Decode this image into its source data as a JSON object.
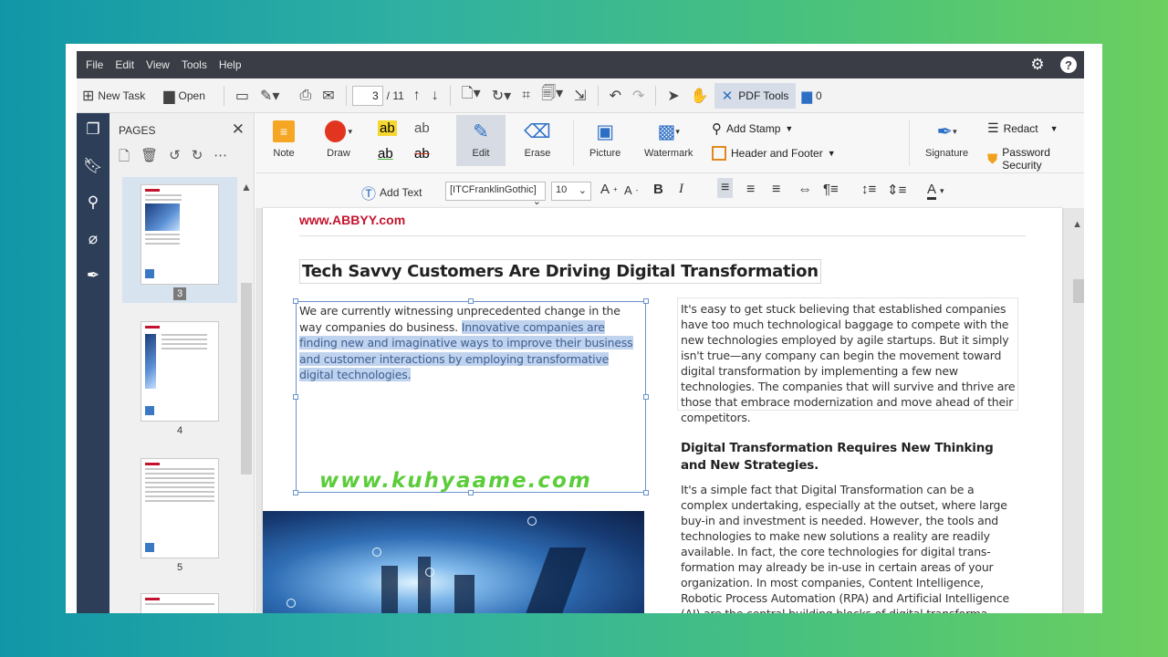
{
  "menu": [
    "File",
    "Edit",
    "View",
    "Tools",
    "Help"
  ],
  "toolbar": {
    "new_task": "New Task",
    "open": "Open",
    "page_current": "3",
    "page_total": "/ 11",
    "pdf_tools": "PDF Tools",
    "comments_count": "0"
  },
  "pages_panel": {
    "title": "PAGES",
    "thumbnails": [
      {
        "number": "3",
        "selected": true
      },
      {
        "number": "4",
        "selected": false
      },
      {
        "number": "5",
        "selected": false
      }
    ]
  },
  "ribbon": {
    "note": "Note",
    "draw": "Draw",
    "edit": "Edit",
    "erase": "Erase",
    "picture": "Picture",
    "watermark": "Watermark",
    "add_stamp": "Add Stamp",
    "header_footer": "Header and Footer",
    "signature": "Signature",
    "redact": "Redact",
    "password_security": "Password Security",
    "text_marks": [
      "ab",
      "ab",
      "ab",
      "ab"
    ]
  },
  "format_bar": {
    "add_text": "Add Text",
    "font": "[ITCFranklinGothic]",
    "size": "10"
  },
  "document": {
    "brand_url": "www.ABBYY.com",
    "headline": "Tech Savvy Customers Are Driving Digital Transformation",
    "left_para_plain": "We are currently witnessing unprecedented change in the way companies do business. ",
    "left_para_highlight": "Innovative companies are finding new and imaginative ways to improve their business and customer interactions by employing transformative digital technologies.",
    "watermark": "www.kuhyaame.com",
    "right_para1": "It's easy to get stuck believing that established companies have too much technological baggage to compete with the new technologies employed by agile startups. But it simply isn't true—any company can begin the movement toward digital transformation by implementing a few new technologies. The companies that will survive and thrive are those that embrace modernization and move ahead of their competitors.",
    "right_heading": "Digital Transformation Requires New Thinking and New Strategies.",
    "right_para2": "It's a simple fact that Digital Transformation can be a complex undertaking, especially at the outset, where large buy-in and investment is needed. However, the tools and technologies to make new solutions a reality are readily available. In fact, the core technologies for digital trans-formation may already be in-use in certain areas of your organization. In most companies, Content Intelligence, Robotic Process Automation (RPA) and Artificial Intelligence (AI) are the central building blocks of digital transforma-"
  },
  "colors": {
    "menubar": "#3a3d45",
    "rail": "#2c3e58",
    "brand_red": "#c3142e",
    "highlight": "#c0d3ee",
    "watermark_green": "#5ccd3a"
  }
}
